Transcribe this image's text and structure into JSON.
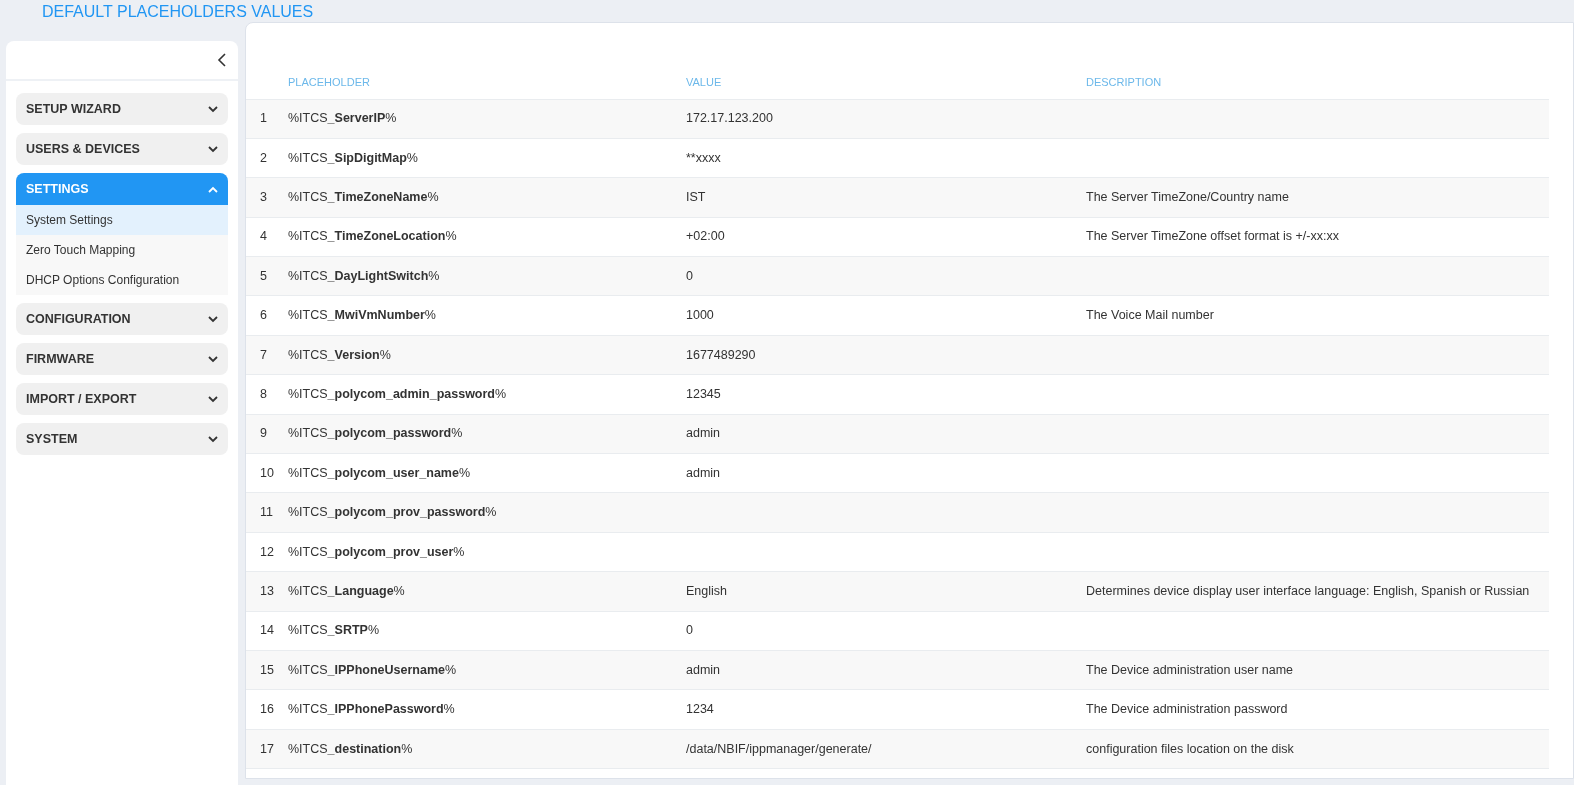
{
  "page_title": "DEFAULT PLACEHOLDERS VALUES",
  "sidebar": {
    "sections": [
      {
        "label": "SETUP WIZARD",
        "expanded": false,
        "selected": false
      },
      {
        "label": "USERS & DEVICES",
        "expanded": false,
        "selected": false
      },
      {
        "label": "SETTINGS",
        "expanded": true,
        "selected": true,
        "items": [
          {
            "label": "System Settings",
            "selected": true
          },
          {
            "label": "Zero Touch Mapping",
            "selected": false
          },
          {
            "label": "DHCP Options Configuration",
            "selected": false
          }
        ]
      },
      {
        "label": "CONFIGURATION",
        "expanded": false,
        "selected": false
      },
      {
        "label": "FIRMWARE",
        "expanded": false,
        "selected": false
      },
      {
        "label": "IMPORT / EXPORT",
        "expanded": false,
        "selected": false
      },
      {
        "label": "SYSTEM",
        "expanded": false,
        "selected": false
      }
    ]
  },
  "table": {
    "columns": [
      "PLACEHOLDER",
      "VALUE",
      "DESCRIPTION"
    ],
    "rows": [
      {
        "index": "1",
        "placeholder": "%ITCS**_ServerIP**%",
        "value": "172.17.123.200"
      },
      {
        "index": "2",
        "placeholder": "%ITCS**_SipDigitMap**%",
        "value": "**xxxx"
      },
      {
        "index": "3",
        "placeholder": "%ITCS**_TimeZoneName**%",
        "value": "IST",
        "description": "The Server TimeZone/Country name"
      },
      {
        "index": "4",
        "placeholder": "%ITCS**_TimeZoneLocation**%",
        "value": "+02:00",
        "description": "The Server TimeZone offset format is +/-xx:xx"
      },
      {
        "index": "5",
        "placeholder": "%ITCS**_DayLightSwitch**%",
        "value": "0"
      },
      {
        "index": "6",
        "placeholder": "%ITCS**_MwiVmNumber**%",
        "value": "1000",
        "description": "The Voice Mail number"
      },
      {
        "index": "7",
        "placeholder": "%ITCS**_Version**%",
        "value": "1677489290"
      },
      {
        "index": "8",
        "placeholder": "%ITCS**_polycom_admin_password**%",
        "value": "12345"
      },
      {
        "index": "9",
        "placeholder": "%ITCS**_polycom_password**%",
        "value": "admin"
      },
      {
        "index": "10",
        "placeholder": "%ITCS**_polycom_user_name**%",
        "value": "admin"
      },
      {
        "index": "11",
        "placeholder": "%ITCS**_polycom_prov_password**%"
      },
      {
        "index": "12",
        "placeholder": "%ITCS**_polycom_prov_user**%"
      },
      {
        "index": "13",
        "placeholder": "%ITCS**_Language**%",
        "value": "English",
        "description": "Determines device display user interface language: English, Spanish or Russian"
      },
      {
        "index": "14",
        "placeholder": "%ITCS**_SRTP**%",
        "value": "0"
      },
      {
        "index": "15",
        "placeholder": "%ITCS**_IPPhoneUsername**%",
        "value": "admin",
        "description": "The Device administration user name"
      },
      {
        "index": "16",
        "placeholder": "%ITCS**_IPPhonePassword**%",
        "value": "1234",
        "description": "The Device administration password"
      },
      {
        "index": "17",
        "placeholder": "%ITCS**_destination**%",
        "value": "/data/NBIF/ippmanager/generate/",
        "description": "configuration files location on the disk"
      }
    ]
  }
}
